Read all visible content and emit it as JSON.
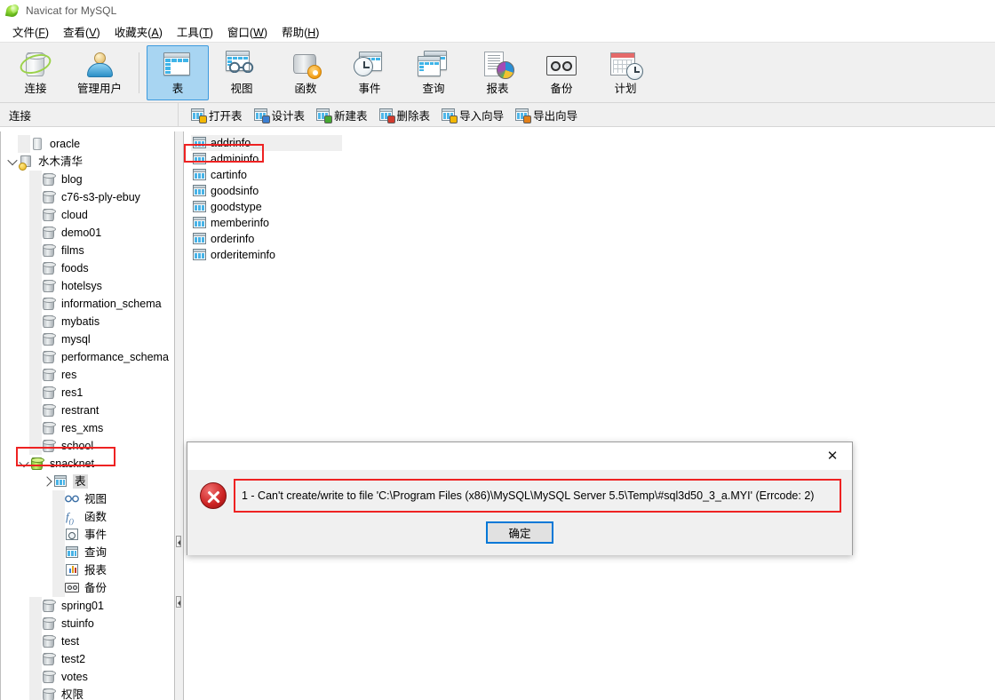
{
  "window": {
    "title": "Navicat for MySQL",
    "logo_icon": "navicat-leaf-icon"
  },
  "menubar": [
    {
      "label": "文件",
      "mnemonic": "F"
    },
    {
      "label": "查看",
      "mnemonic": "V"
    },
    {
      "label": "收藏夹",
      "mnemonic": "A"
    },
    {
      "label": "工具",
      "mnemonic": "T"
    },
    {
      "label": "窗口",
      "mnemonic": "W"
    },
    {
      "label": "帮助",
      "mnemonic": "H"
    }
  ],
  "toolbar": {
    "buttons": [
      {
        "label": "连接",
        "icon": "connection-icon",
        "selected": false
      },
      {
        "label": "管理用户",
        "icon": "manage-users-icon",
        "selected": false
      },
      {
        "label": "表",
        "icon": "table-icon",
        "selected": true
      },
      {
        "label": "视图",
        "icon": "view-icon",
        "selected": false
      },
      {
        "label": "函数",
        "icon": "function-icon",
        "selected": false
      },
      {
        "label": "事件",
        "icon": "event-icon",
        "selected": false
      },
      {
        "label": "查询",
        "icon": "query-icon",
        "selected": false
      },
      {
        "label": "报表",
        "icon": "report-icon",
        "selected": false
      },
      {
        "label": "备份",
        "icon": "backup-icon",
        "selected": false
      },
      {
        "label": "计划",
        "icon": "schedule-icon",
        "selected": false
      }
    ]
  },
  "midbar": {
    "connection_label": "连接",
    "actions": [
      {
        "label": "打开表",
        "icon": "open-table-icon",
        "badge": "y"
      },
      {
        "label": "设计表",
        "icon": "design-table-icon",
        "badge": "b"
      },
      {
        "label": "新建表",
        "icon": "new-table-icon",
        "badge": "g"
      },
      {
        "label": "删除表",
        "icon": "delete-table-icon",
        "badge": "r"
      },
      {
        "label": "导入向导",
        "icon": "import-wizard-icon",
        "badge": "y"
      },
      {
        "label": "导出向导",
        "icon": "export-wizard-icon",
        "badge": "o"
      }
    ]
  },
  "sidebar": {
    "nodes": [
      {
        "label": "oracle",
        "icon": "oracle-connection-icon",
        "indent": 1,
        "twisty": "none",
        "dots": true
      },
      {
        "label": "水木清华",
        "icon": "mysql-connection-icon",
        "indent": 0,
        "twisty": "open",
        "dots": false
      },
      {
        "label": "blog",
        "icon": "database-icon",
        "indent": 2,
        "twisty": "none",
        "dots": true
      },
      {
        "label": "c76-s3-ply-ebuy",
        "icon": "database-icon",
        "indent": 2,
        "twisty": "none",
        "dots": true
      },
      {
        "label": "cloud",
        "icon": "database-icon",
        "indent": 2,
        "twisty": "none",
        "dots": true
      },
      {
        "label": "demo01",
        "icon": "database-icon",
        "indent": 2,
        "twisty": "none",
        "dots": true
      },
      {
        "label": "films",
        "icon": "database-icon",
        "indent": 2,
        "twisty": "none",
        "dots": true
      },
      {
        "label": "foods",
        "icon": "database-icon",
        "indent": 2,
        "twisty": "none",
        "dots": true
      },
      {
        "label": "hotelsys",
        "icon": "database-icon",
        "indent": 2,
        "twisty": "none",
        "dots": true
      },
      {
        "label": "information_schema",
        "icon": "database-icon",
        "indent": 2,
        "twisty": "none",
        "dots": true
      },
      {
        "label": "mybatis",
        "icon": "database-icon",
        "indent": 2,
        "twisty": "none",
        "dots": true
      },
      {
        "label": "mysql",
        "icon": "database-icon",
        "indent": 2,
        "twisty": "none",
        "dots": true
      },
      {
        "label": "performance_schema",
        "icon": "database-icon",
        "indent": 2,
        "twisty": "none",
        "dots": true
      },
      {
        "label": "res",
        "icon": "database-icon",
        "indent": 2,
        "twisty": "none",
        "dots": true
      },
      {
        "label": "res1",
        "icon": "database-icon",
        "indent": 2,
        "twisty": "none",
        "dots": true
      },
      {
        "label": "restrant",
        "icon": "database-icon",
        "indent": 2,
        "twisty": "none",
        "dots": true
      },
      {
        "label": "res_xms",
        "icon": "database-icon",
        "indent": 2,
        "twisty": "none",
        "dots": true
      },
      {
        "label": "school",
        "icon": "database-icon",
        "indent": 2,
        "twisty": "none",
        "dots": true
      },
      {
        "label": "snacknet",
        "icon": "database-open-icon",
        "indent": 1,
        "twisty": "open",
        "dots": false,
        "annotated": true
      },
      {
        "label": "表",
        "icon": "tables-folder-icon",
        "indent": 3,
        "twisty": "closed",
        "dots": false,
        "selected": true
      },
      {
        "label": "视图",
        "icon": "views-folder-icon",
        "indent": 4,
        "twisty": "none",
        "dots": true
      },
      {
        "label": "函数",
        "icon": "functions-folder-icon",
        "indent": 4,
        "twisty": "none",
        "dots": true
      },
      {
        "label": "事件",
        "icon": "events-folder-icon",
        "indent": 4,
        "twisty": "none",
        "dots": true
      },
      {
        "label": "查询",
        "icon": "queries-folder-icon",
        "indent": 4,
        "twisty": "none",
        "dots": true
      },
      {
        "label": "报表",
        "icon": "reports-folder-icon",
        "indent": 4,
        "twisty": "none",
        "dots": true
      },
      {
        "label": "备份",
        "icon": "backups-folder-icon",
        "indent": 4,
        "twisty": "none",
        "dots": true
      },
      {
        "label": "spring01",
        "icon": "database-icon",
        "indent": 2,
        "twisty": "none",
        "dots": true
      },
      {
        "label": "stuinfo",
        "icon": "database-icon",
        "indent": 2,
        "twisty": "none",
        "dots": true
      },
      {
        "label": "test",
        "icon": "database-icon",
        "indent": 2,
        "twisty": "none",
        "dots": true
      },
      {
        "label": "test2",
        "icon": "database-icon",
        "indent": 2,
        "twisty": "none",
        "dots": true
      },
      {
        "label": "votes",
        "icon": "database-icon",
        "indent": 2,
        "twisty": "none",
        "dots": true
      },
      {
        "label": "权限",
        "icon": "database-icon",
        "indent": 2,
        "twisty": "none",
        "dots": true
      }
    ]
  },
  "tables": [
    {
      "name": "addrinfo",
      "highlighted": true,
      "annotated": false
    },
    {
      "name": "admininfo",
      "highlighted": false,
      "annotated": true
    },
    {
      "name": "cartinfo",
      "highlighted": false,
      "annotated": false
    },
    {
      "name": "goodsinfo",
      "highlighted": false,
      "annotated": false
    },
    {
      "name": "goodstype",
      "highlighted": false,
      "annotated": false
    },
    {
      "name": "memberinfo",
      "highlighted": false,
      "annotated": false
    },
    {
      "name": "orderinfo",
      "highlighted": false,
      "annotated": false
    },
    {
      "name": "orderiteminfo",
      "highlighted": false,
      "annotated": false
    }
  ],
  "dialog": {
    "close_label": "✕",
    "error_icon": "error-cross-icon",
    "message": "1 - Can't create/write to file 'C:\\Program Files (x86)\\MySQL\\MySQL Server 5.5\\Temp\\#sql3d50_3_a.MYI' (Errcode: 2)",
    "ok_label": "确定"
  },
  "colors": {
    "accent_blue": "#0078d7",
    "selected_toolbar": "#a8d5f2",
    "annotation_red": "#ee2222",
    "error_red": "#cc2222",
    "toolbar_bg": "#f0f0f0"
  }
}
